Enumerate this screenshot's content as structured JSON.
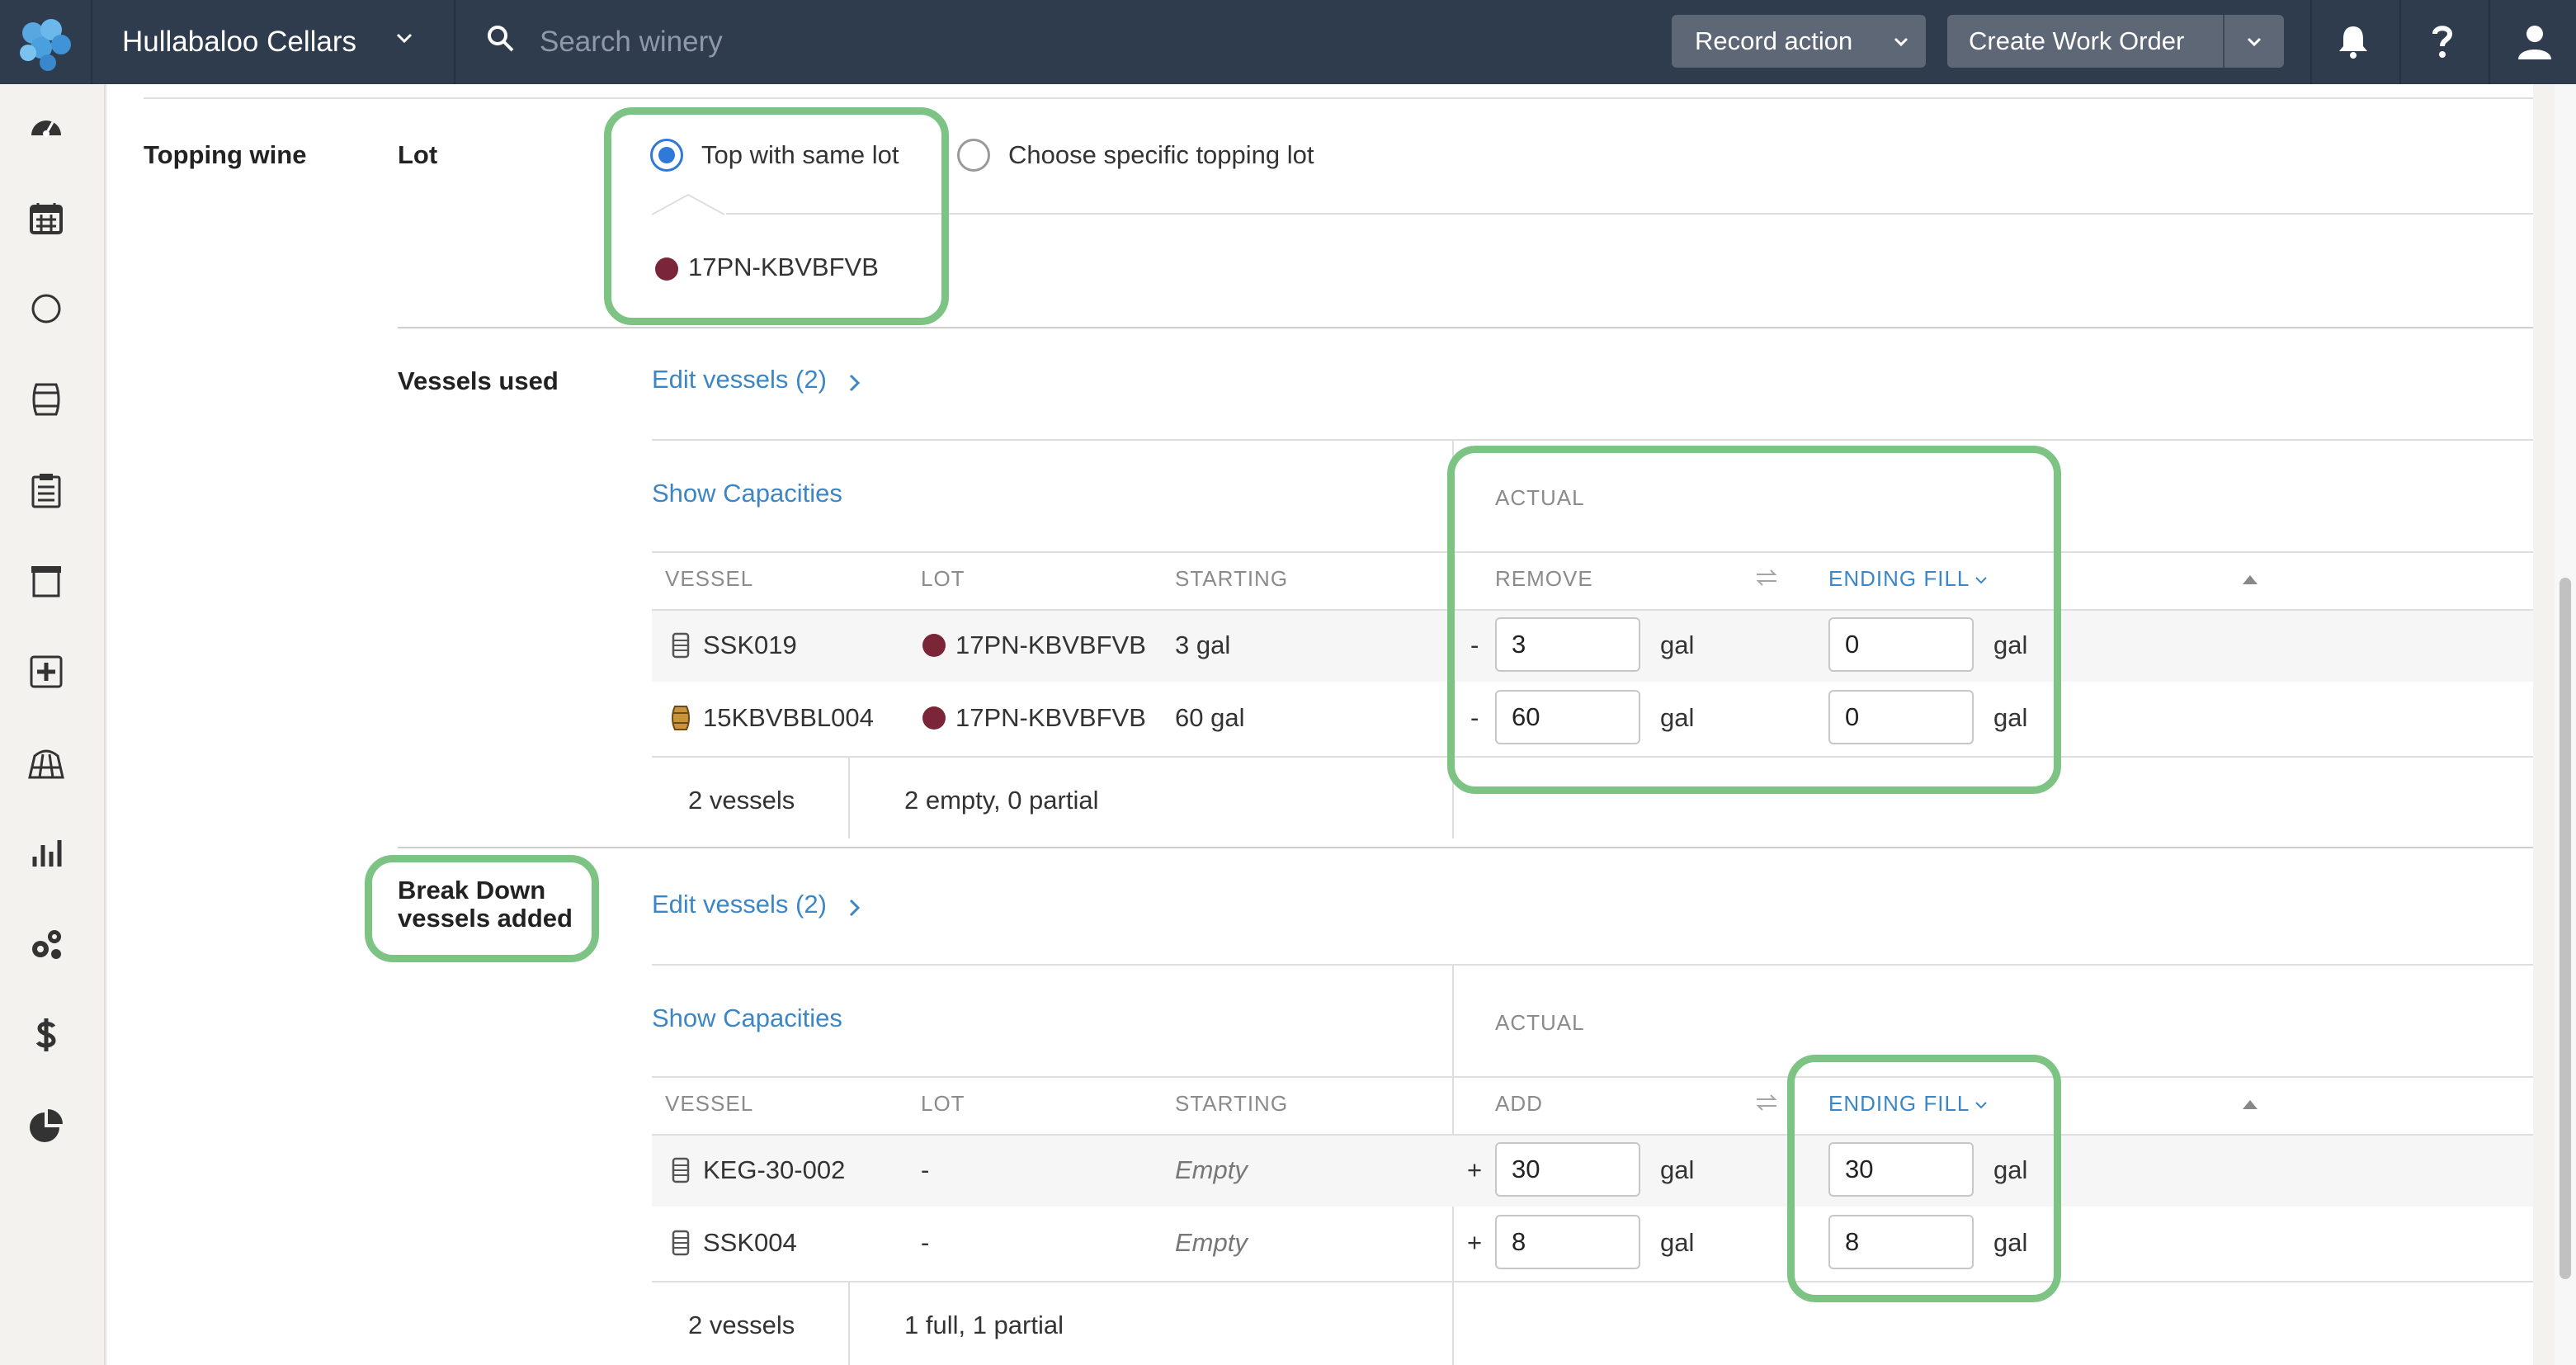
{
  "topbar": {
    "org_name": "Hullabaloo Cellars",
    "search_placeholder": "Search winery",
    "record_action_label": "Record action",
    "create_work_order_label": "Create Work Order"
  },
  "section": {
    "topping_wine_label": "Topping wine",
    "lot_label": "Lot",
    "top_same_lot_label": "Top with same lot",
    "choose_specific_label": "Choose specific topping lot",
    "selected_lot": "17PN-KBVBFVB",
    "lot_color": "#7a2638"
  },
  "vessels_used": {
    "label": "Vessels used",
    "edit_link": "Edit vessels (2)",
    "show_capacities": "Show Capacities",
    "actual_label": "ACTUAL",
    "columns": {
      "vessel": "VESSEL",
      "lot": "LOT",
      "starting": "STARTING",
      "remove": "REMOVE",
      "ending_fill": "ENDING FILL"
    },
    "rows": [
      {
        "sign": "-",
        "vessel": "SSK019",
        "lot": "17PN-KBVBFVB",
        "starting": "3 gal",
        "amount": "3",
        "amount_unit": "gal",
        "ending": "0",
        "ending_unit": "gal"
      },
      {
        "sign": "-",
        "vessel": "15KBVBBL004",
        "lot": "17PN-KBVBFVB",
        "starting": "60 gal",
        "amount": "60",
        "amount_unit": "gal",
        "ending": "0",
        "ending_unit": "gal"
      }
    ],
    "footer_count": "2 vessels",
    "footer_summary": "2 empty, 0 partial"
  },
  "breakdown": {
    "label_line1": "Break Down",
    "label_line2": "vessels added",
    "edit_link": "Edit vessels (2)",
    "show_capacities": "Show Capacities",
    "actual_label": "ACTUAL",
    "columns": {
      "vessel": "VESSEL",
      "lot": "LOT",
      "starting": "STARTING",
      "add": "ADD",
      "ending_fill": "ENDING FILL"
    },
    "rows": [
      {
        "sign": "+",
        "vessel": "KEG-30-002",
        "lot": "-",
        "starting": "Empty",
        "amount": "30",
        "amount_unit": "gal",
        "ending": "30",
        "ending_unit": "gal"
      },
      {
        "sign": "+",
        "vessel": "SSK004",
        "lot": "-",
        "starting": "Empty",
        "amount": "8",
        "amount_unit": "gal",
        "ending": "8",
        "ending_unit": "gal"
      }
    ],
    "footer_count": "2 vessels",
    "footer_summary": "1 full, 1 partial"
  },
  "colors": {
    "highlight": "#7dc484",
    "link": "#3d86c6",
    "topbar": "#2f3c4e"
  }
}
